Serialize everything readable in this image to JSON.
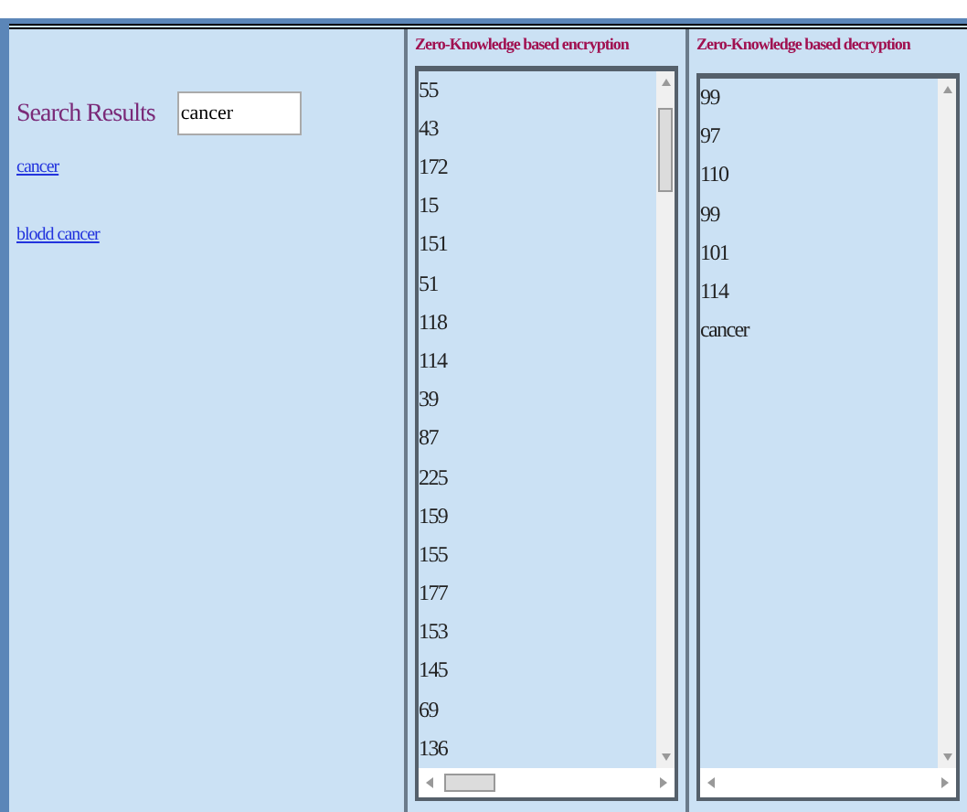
{
  "search": {
    "label": "Search Results",
    "value": "cancer"
  },
  "results": [
    "cancer",
    "blodd cancer"
  ],
  "encryption": {
    "title": "Zero-Knowledge based encryption",
    "lines": [
      "55",
      "43",
      "172",
      "15",
      "151",
      "51",
      "118",
      "114",
      "39",
      "87",
      "225",
      "159",
      "155",
      "177",
      "153",
      "145",
      "69",
      "136"
    ]
  },
  "decryption": {
    "title": "Zero-Knowledge based decryption",
    "lines": [
      "99",
      "97",
      "110",
      "99",
      "101",
      "114",
      "cancer"
    ]
  }
}
